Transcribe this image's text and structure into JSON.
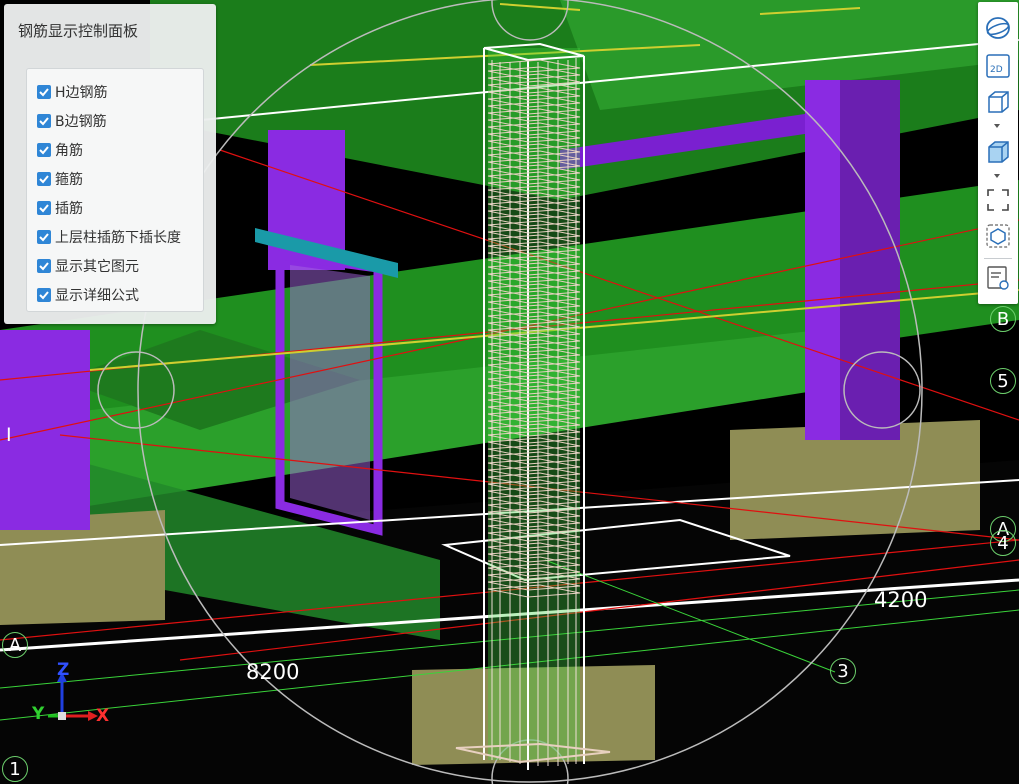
{
  "panel": {
    "title": "钢筋显示控制面板",
    "options": [
      {
        "label": "H边钢筋",
        "checked": true
      },
      {
        "label": "B边钢筋",
        "checked": true
      },
      {
        "label": "角筋",
        "checked": true
      },
      {
        "label": "箍筋",
        "checked": true
      },
      {
        "label": "插筋",
        "checked": true
      },
      {
        "label": "上层柱插筋下插长度",
        "checked": true
      },
      {
        "label": "显示其它图元",
        "checked": true
      },
      {
        "label": "显示详细公式",
        "checked": true
      }
    ]
  },
  "toolbar": {
    "tools": [
      "orbit-icon",
      "view-2d-icon",
      "wireframe-box-icon",
      "solid-box-icon",
      "zoom-extents-icon",
      "fit-view-icon",
      "properties-view-icon"
    ],
    "view2d_label": "2D"
  },
  "dimensions": {
    "left": "8200",
    "right": "4200"
  },
  "grid_axes": {
    "axis_1": "1",
    "axis_3": "3",
    "axis_4": "4",
    "axis_5": "5",
    "axis_A_left": "A",
    "axis_A_right": "A",
    "axis_B": "B",
    "axis_I": "I"
  },
  "coordinate_indicator": {
    "x": "X",
    "y": "Y",
    "z": "Z"
  },
  "colors": {
    "beam": "#1f8f1f",
    "column": "#8a2be2",
    "footing": "#8f8d55",
    "checkbox": "#2f86d6",
    "grid_line": "#e01010",
    "axis_line": "#cfcf30"
  }
}
